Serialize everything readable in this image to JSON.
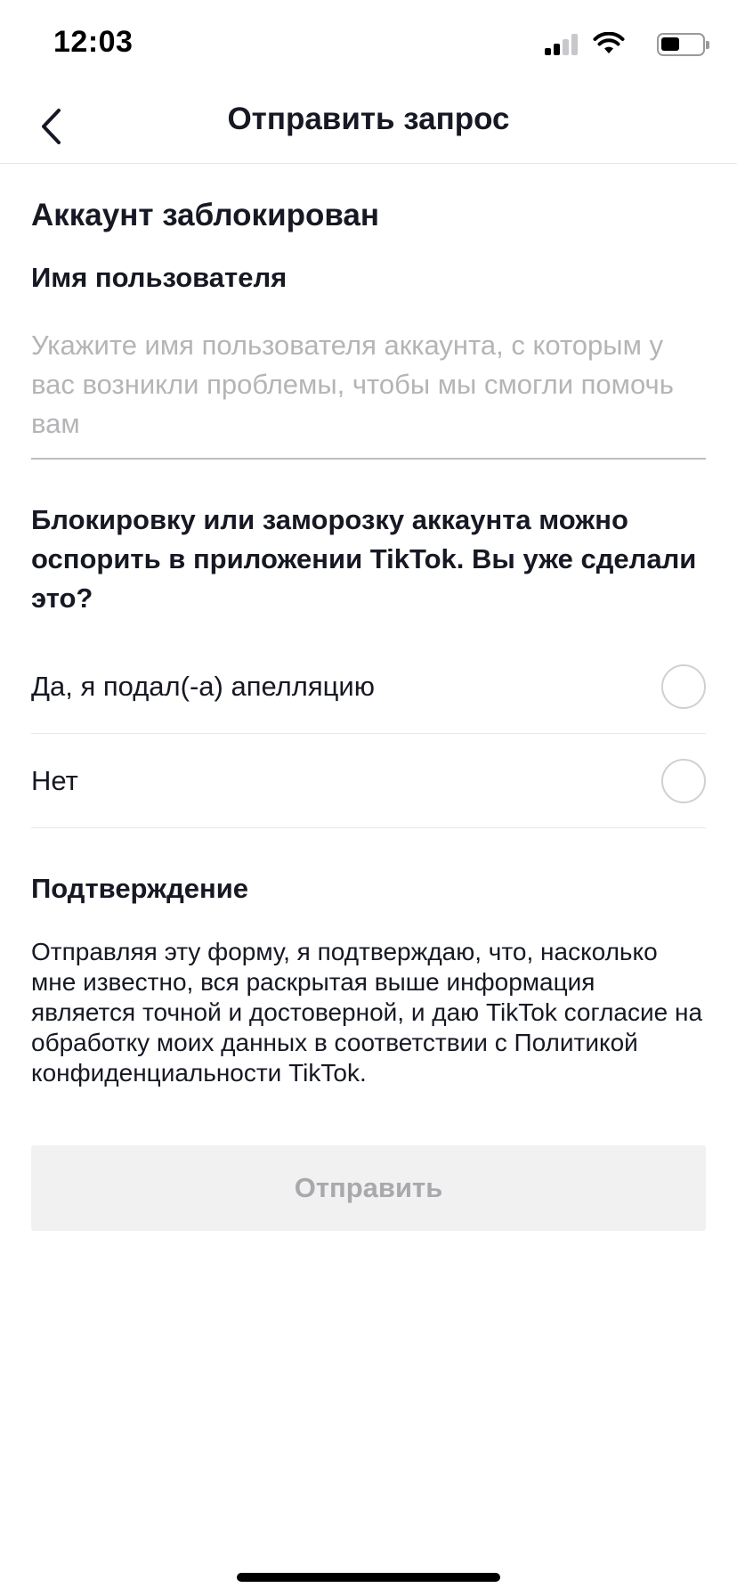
{
  "status_bar": {
    "time": "12:03",
    "icons": [
      "signal-icon",
      "wifi-icon",
      "battery-icon"
    ]
  },
  "nav": {
    "title": "Отправить запрос",
    "back_icon": "chevron-left-icon"
  },
  "form": {
    "section_title": "Аккаунт заблокирован",
    "username": {
      "label": "Имя пользователя",
      "value": "",
      "placeholder": "Укажите имя пользователя аккаунта, с которым у вас возникли проблемы, чтобы мы смогли помочь вам"
    },
    "question": "Блокировку или заморозку аккаунта можно оспорить в приложении TikTok. Вы уже сделали это?",
    "options": [
      {
        "label": "Да, я подал(-а) апелляцию",
        "selected": false
      },
      {
        "label": "Нет",
        "selected": false
      }
    ],
    "confirmation": {
      "title": "Подтверждение",
      "text": "Отправляя эту форму, я подтверждаю, что, насколько мне известно, вся раскрытая выше информация является точной и достоверной, и даю TikTok согласие на обработку моих данных в соответствии с Политикой конфиденциальности TikTok."
    },
    "submit": {
      "label": "Отправить",
      "enabled": false
    }
  },
  "colors": {
    "text": "#161823",
    "placeholder": "#b5b5b8",
    "divider": "#e8e8e8",
    "disabled_button_bg": "#f1f1f2",
    "disabled_button_text": "#a8a8ad"
  }
}
